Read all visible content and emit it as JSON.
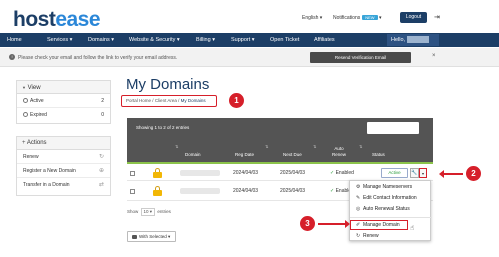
{
  "brand": {
    "part1": "host",
    "part2": "ease"
  },
  "header": {
    "language": "English ▾",
    "notifications_label": "Notifications",
    "notifications_badge": "NEW",
    "notifications_caret": "▾",
    "logout_label": "Logout",
    "exit_icon": "⇥"
  },
  "nav": {
    "items": [
      "Home",
      "Services ▾",
      "Domains ▾",
      "Website & Security ▾",
      "Billing ▾",
      "Support ▾",
      "Open Ticket",
      "Affiliates"
    ],
    "hello": "Hello,"
  },
  "alert": {
    "icon": "!",
    "text": "Please check your email and follow the link to verify your email address.",
    "resend_label": "Resend Verification Email",
    "close": "×"
  },
  "sidebar": {
    "view": {
      "title": "View",
      "icon": "▼",
      "items": [
        {
          "label": "Active",
          "count": "2"
        },
        {
          "label": "Expired",
          "count": "0"
        }
      ]
    },
    "actions": {
      "title": "Actions",
      "icon": "+",
      "items": [
        {
          "label": "Renew",
          "icon": "↻"
        },
        {
          "label": "Register a New Domain",
          "icon": "⊕"
        },
        {
          "label": "Transfer in a Domain",
          "icon": "⇄"
        }
      ]
    }
  },
  "main": {
    "title": "My Domains",
    "breadcrumb": {
      "home": "Portal Home",
      "sep": "/",
      "mid": "Client Area",
      "current": "My Domains"
    },
    "showing": "Showing 1 to 2 of 2 entries",
    "columns": {
      "domain": "Domain",
      "reg_date": "Reg Date",
      "next_due": "Next Due",
      "auto_renew": "Auto Renew",
      "status": "Status"
    },
    "sort_icon": "⇅",
    "rows": [
      {
        "reg_date": "2024/04/03",
        "next_due": "2025/04/03",
        "auto_renew": "Enabled",
        "status": "Active"
      },
      {
        "reg_date": "2024/04/03",
        "next_due": "2025/04/03",
        "auto_renew": "Enabled"
      }
    ],
    "check_icon": "✓",
    "wrench_icon": "🔧",
    "caret_icon": "▾",
    "show_prefix": "Show",
    "show_value": "10 ▾",
    "show_suffix": "entries",
    "with_selected": "With Selected ▾"
  },
  "dropdown": {
    "items": [
      {
        "icon": "⚙",
        "label": "Manage Nameservers"
      },
      {
        "icon": "✎",
        "label": "Edit Contact Information"
      },
      {
        "icon": "◎",
        "label": "Auto Renewal Status"
      },
      {
        "icon": "✐",
        "label": "Manage Domain"
      },
      {
        "icon": "↻",
        "label": "Renew"
      }
    ],
    "pointer": "☝"
  },
  "annotations": [
    "1",
    "2",
    "3"
  ],
  "colors": {
    "navy": "#1c3e66",
    "accent": "#2b87d8",
    "annotation_red": "#d61f2a",
    "success": "#2a9d3a"
  }
}
